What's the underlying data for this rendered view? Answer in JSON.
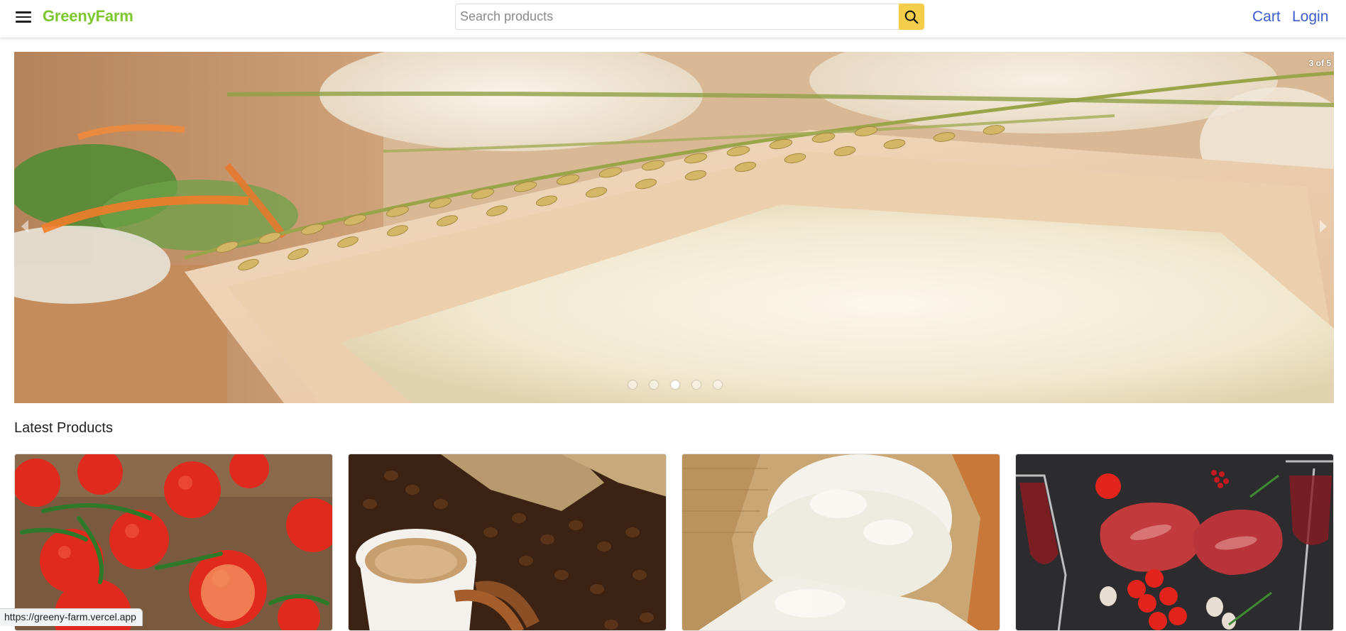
{
  "header": {
    "menu_icon": "hamburger-menu-icon",
    "brand": "GreenyFarm",
    "brand_color": "#7cc62e",
    "search": {
      "placeholder": "Search products",
      "value": "",
      "button_icon": "search-icon",
      "button_color": "#f4cd4b"
    },
    "nav": {
      "cart": "Cart",
      "login": "Login",
      "link_color": "#3a5ccc"
    }
  },
  "carousel": {
    "counter": "3 of 5",
    "total_slides": 5,
    "active_index": 2,
    "prev_icon": "chevron-left-icon",
    "next_icon": "chevron-right-icon"
  },
  "latest": {
    "title": "Latest Products"
  },
  "status_bar": {
    "url": "https://greeny-farm.vercel.app"
  }
}
